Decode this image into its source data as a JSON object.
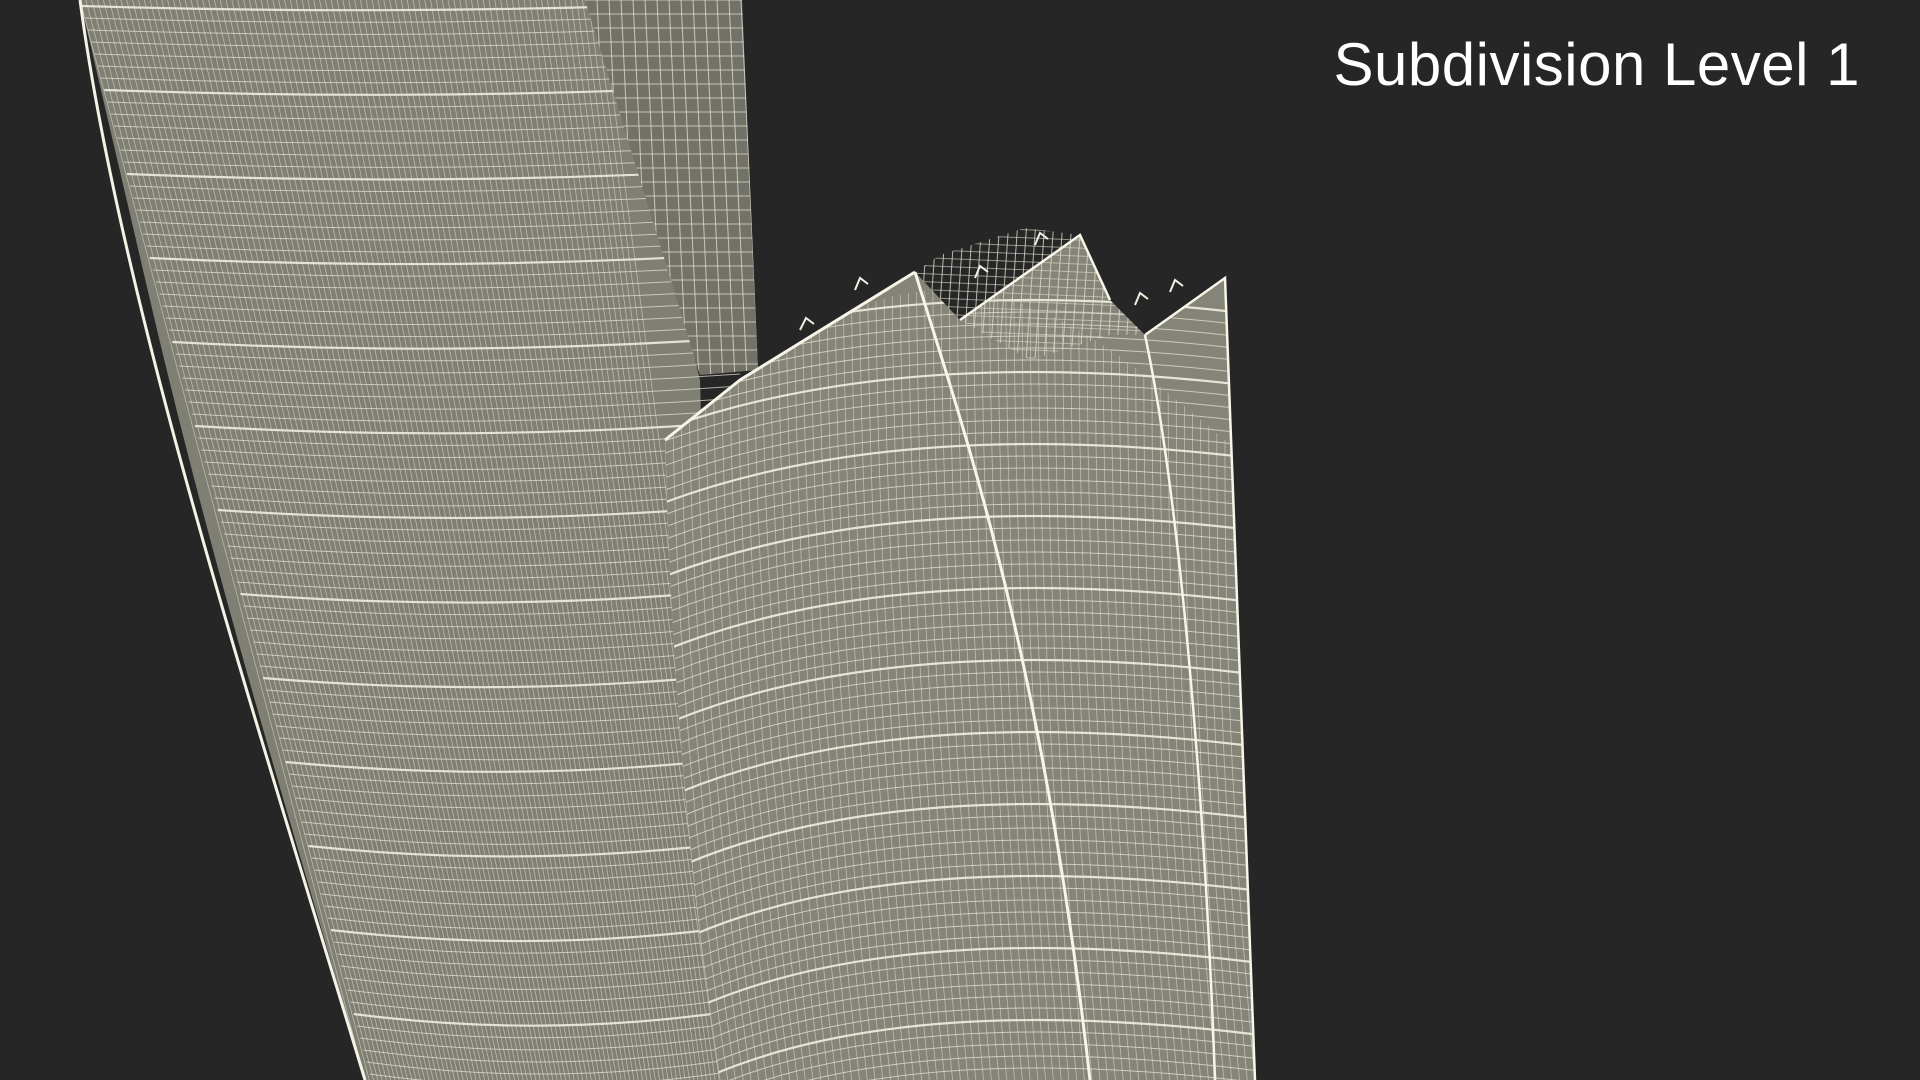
{
  "overlay": {
    "label": "Subdivision Level 1"
  },
  "render": {
    "description_icon": "wireframe-towers",
    "colors": {
      "background": "#262626",
      "surface": "#8a8a7e",
      "wire": "#f2f0e2",
      "wire_dim": "#c9c7b8"
    }
  }
}
